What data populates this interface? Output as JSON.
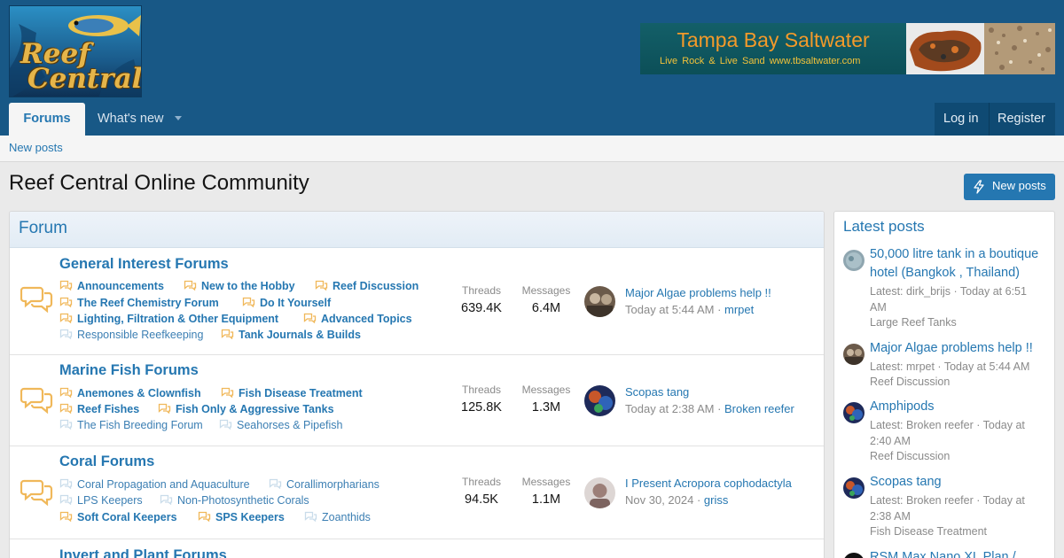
{
  "logo": {
    "line1": "Reef",
    "line2": "Central"
  },
  "ad": {
    "title": "Tampa Bay Saltwater",
    "subtitle": "Live Rock & Live Sand   www.tbsaltwater.com"
  },
  "nav": {
    "forums": "Forums",
    "whats_new": "What's new",
    "login": "Log in",
    "register": "Register"
  },
  "subnav": {
    "new_posts": "New posts"
  },
  "page": {
    "title": "Reef Central Online Community",
    "new_posts_button": "New posts"
  },
  "forum": {
    "header": "Forum",
    "stat_threads_label": "Threads",
    "stat_messages_label": "Messages",
    "nodes": [
      {
        "title": "General Interest Forums",
        "subforums": [
          {
            "label": "Announcements",
            "unread": true
          },
          {
            "label": "New to the Hobby",
            "unread": true
          },
          {
            "label": "Reef Discussion",
            "unread": true
          },
          {
            "label": "The Reef Chemistry Forum",
            "unread": true
          },
          {
            "label": "Do It Yourself",
            "unread": true
          },
          {
            "label": "Lighting, Filtration & Other Equipment",
            "unread": true
          },
          {
            "label": "Advanced Topics",
            "unread": true
          },
          {
            "label": "Responsible Reefkeeping",
            "unread": false
          },
          {
            "label": "Tank Journals & Builds",
            "unread": true
          }
        ],
        "threads": "639.4K",
        "messages": "6.4M",
        "last_post": {
          "title": "Major Algae problems help !!",
          "time": "Today at 5:44 AM",
          "user": "mrpet"
        }
      },
      {
        "title": "Marine Fish Forums",
        "subforums": [
          {
            "label": "Anemones & Clownfish",
            "unread": true
          },
          {
            "label": "Fish Disease Treatment",
            "unread": true
          },
          {
            "label": "Reef Fishes",
            "unread": true
          },
          {
            "label": "Fish Only & Aggressive Tanks",
            "unread": true
          },
          {
            "label": "The Fish Breeding Forum",
            "unread": false
          },
          {
            "label": "Seahorses & Pipefish",
            "unread": false
          }
        ],
        "threads": "125.8K",
        "messages": "1.3M",
        "last_post": {
          "title": "Scopas tang",
          "time": "Today at 2:38 AM",
          "user": "Broken reefer"
        }
      },
      {
        "title": "Coral Forums",
        "subforums": [
          {
            "label": "Coral Propagation and Aquaculture",
            "unread": false
          },
          {
            "label": "Corallimorpharians",
            "unread": false
          },
          {
            "label": "LPS Keepers",
            "unread": false
          },
          {
            "label": "Non-Photosynthetic Corals",
            "unread": false
          },
          {
            "label": "Soft Coral Keepers",
            "unread": true
          },
          {
            "label": "SPS Keepers",
            "unread": true
          },
          {
            "label": "Zoanthids",
            "unread": false
          }
        ],
        "threads": "94.5K",
        "messages": "1.1M",
        "last_post": {
          "title": "I Present Acropora cophodactyla",
          "time": "Nov 30, 2024",
          "user": "griss"
        }
      },
      {
        "title": "Invert and Plant Forums"
      }
    ]
  },
  "sidebar": {
    "header": "Latest posts",
    "items": [
      {
        "title": "50,000 litre tank in a boutique hotel (Bangkok , Thailand)",
        "meta": "Latest: dirk_brijs · Today at 6:51 AM",
        "forum": "Large Reef Tanks"
      },
      {
        "title": "Major Algae problems help !!",
        "meta": "Latest: mrpet · Today at 5:44 AM",
        "forum": "Reef Discussion"
      },
      {
        "title": "Amphipods",
        "meta": "Latest: Broken reefer · Today at 2:40 AM",
        "forum": "Reef Discussion"
      },
      {
        "title": "Scopas tang",
        "meta": "Latest: Broken reefer · Today at 2:38 AM",
        "forum": "Fish Disease Treatment"
      },
      {
        "title": "RSM Max Nano XL Plan /",
        "meta": "",
        "forum": ""
      }
    ]
  },
  "colors": {
    "header_bg": "#185886",
    "link": "#2577b1",
    "unread_icon": "#f0b85a",
    "read_icon": "#c9dcea"
  }
}
